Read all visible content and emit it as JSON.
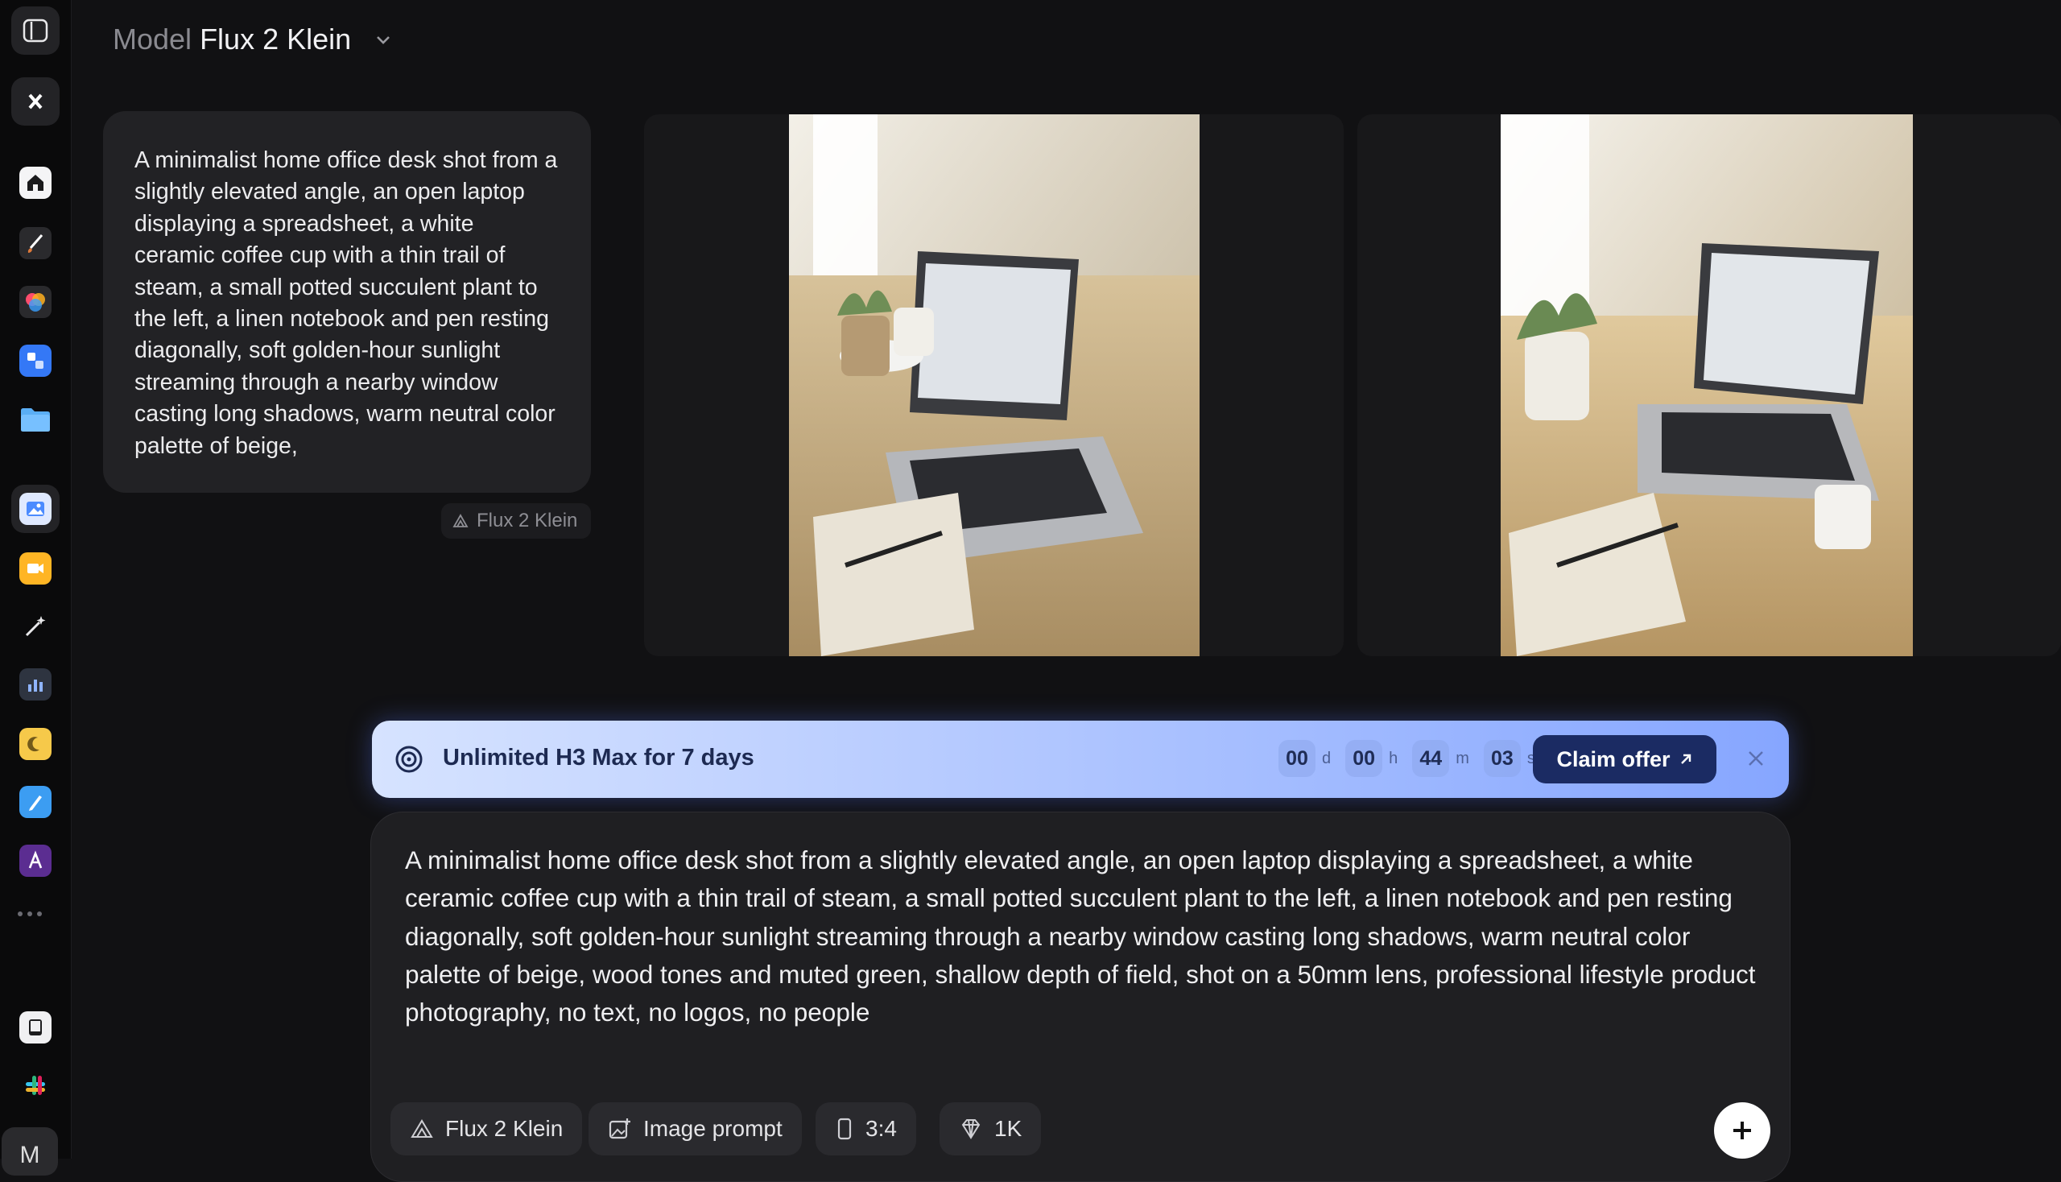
{
  "header": {
    "model_label": "Model",
    "model_value": "Flux 2 Klein"
  },
  "sidebar": {
    "items": [
      {
        "name": "toggle-sidebar-icon"
      },
      {
        "name": "workspace-icon"
      },
      {
        "name": "home-icon"
      },
      {
        "name": "brush-icon"
      },
      {
        "name": "color-wheel-icon"
      },
      {
        "name": "blocks-icon"
      },
      {
        "name": "folder-icon"
      },
      {
        "name": "image-icon"
      },
      {
        "name": "video-icon"
      },
      {
        "name": "magic-wand-icon"
      },
      {
        "name": "chart-icon"
      },
      {
        "name": "moon-icon"
      },
      {
        "name": "pen-icon"
      },
      {
        "name": "font-icon"
      },
      {
        "name": "more-icon"
      },
      {
        "name": "tablet-icon"
      },
      {
        "name": "slack-icon"
      }
    ],
    "avatar_letter": "M"
  },
  "history": {
    "prompt": "A minimalist home office desk shot from a slightly elevated angle, an open laptop displaying a spreadsheet, a white ceramic coffee cup with a thin trail of steam, a small potted succulent plant to the left, a linen notebook and pen resting diagonally, soft golden-hour sunlight streaming through a nearby window casting long shadows, warm neutral color palette of beige,",
    "model_chip": "Flux 2 Klein"
  },
  "promo": {
    "title": "Unlimited H3 Max for 7 days",
    "timer": [
      {
        "value": "00",
        "unit": "d"
      },
      {
        "value": "00",
        "unit": "h"
      },
      {
        "value": "44",
        "unit": "m"
      },
      {
        "value": "03",
        "unit": "s"
      }
    ],
    "cta": "Claim offer"
  },
  "composer": {
    "text": "A minimalist home office desk shot from a slightly elevated angle, an open laptop displaying a spreadsheet, a white ceramic coffee cup with a thin trail of steam, a small potted succulent plant to the left, a linen notebook and pen resting diagonally, soft golden-hour sunlight streaming through a nearby window casting long shadows, warm neutral color palette of beige, wood tones and muted green, shallow depth of field, shot on a 50mm lens, professional lifestyle product photography, no text, no logos, no people",
    "model_button": "Flux 2 Klein",
    "image_prompt_button": "Image prompt",
    "aspect_button": "3:4",
    "quality_button": "1K"
  },
  "colors": {
    "accent": "#1b2b63",
    "promo_start": "#d6e3ff",
    "promo_end": "#86a6ff"
  }
}
